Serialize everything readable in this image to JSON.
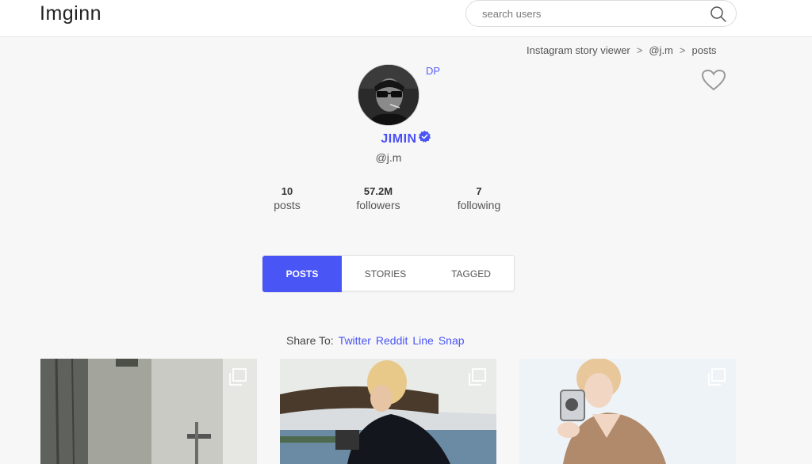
{
  "header": {
    "logo": "Imginn",
    "search_placeholder": "search users"
  },
  "breadcrumb": {
    "items": [
      "Instagram story viewer",
      "@j.m",
      "posts"
    ],
    "separator": ">"
  },
  "profile": {
    "dp_label": "DP",
    "name": "JIMIN",
    "handle": "@j.m",
    "verified": true,
    "stats": [
      {
        "value": "10",
        "label": "posts"
      },
      {
        "value": "57.2M",
        "label": "followers"
      },
      {
        "value": "7",
        "label": "following"
      }
    ]
  },
  "tabs": [
    "POSTS",
    "STORIES",
    "TAGGED"
  ],
  "active_tab": "POSTS",
  "share": {
    "label": "Share To:",
    "links": [
      "Twitter",
      "Reddit",
      "Line",
      "Snap"
    ]
  },
  "colors": {
    "accent": "#4a55f5",
    "name": "#4a4ef6",
    "background": "#f7f7f7"
  },
  "icons": {
    "search": "search-icon",
    "heart": "heart-icon",
    "verified": "verified-badge-icon",
    "multi": "multiple-images-icon"
  }
}
